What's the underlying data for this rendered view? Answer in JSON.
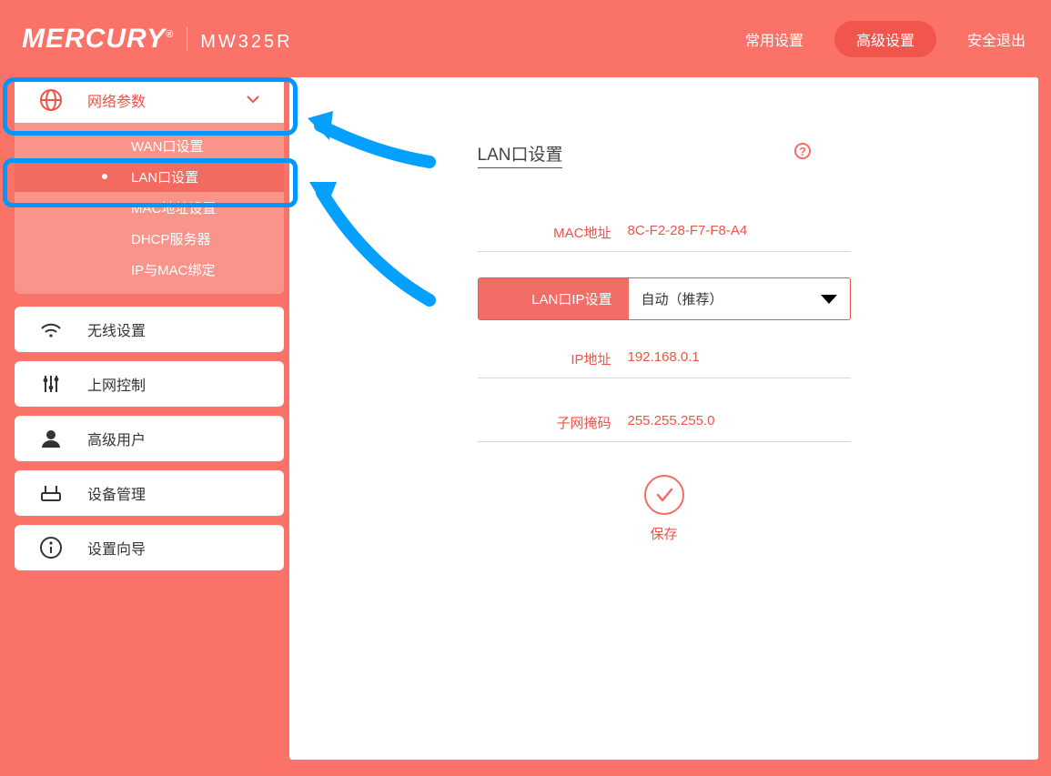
{
  "brand": {
    "name": "MERCURY",
    "model": "MW325R"
  },
  "topnav": {
    "common": "常用设置",
    "advanced": "高级设置",
    "logout": "安全退出"
  },
  "sidebar": {
    "items": [
      {
        "label": "网络参数"
      },
      {
        "label": "无线设置"
      },
      {
        "label": "上网控制"
      },
      {
        "label": "高级用户"
      },
      {
        "label": "设备管理"
      },
      {
        "label": "设置向导"
      }
    ],
    "submenu": [
      {
        "label": "WAN口设置"
      },
      {
        "label": "LAN口设置"
      },
      {
        "label": "MAC地址设置"
      },
      {
        "label": "DHCP服务器"
      },
      {
        "label": "IP与MAC绑定"
      }
    ]
  },
  "panel": {
    "title": "LAN口设置",
    "mac_label": "MAC地址",
    "mac_value": "8C-F2-28-F7-F8-A4",
    "ipmode_label": "LAN口IP设置",
    "ipmode_value": "自动（推荐）",
    "ip_label": "IP地址",
    "ip_value": "192.168.0.1",
    "mask_label": "子网掩码",
    "mask_value": "255.255.255.0",
    "save": "保存",
    "help": "?"
  }
}
